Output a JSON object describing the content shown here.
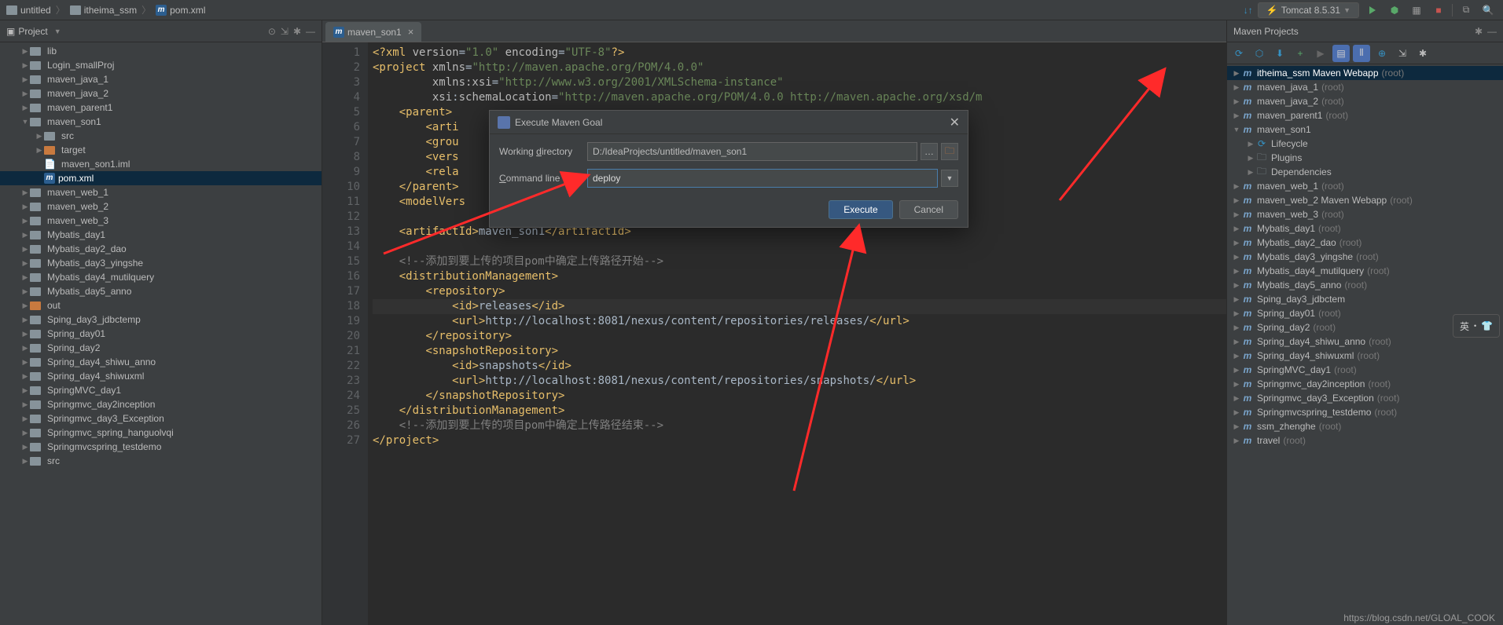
{
  "breadcrumb": {
    "a": "untitled",
    "b": "itheima_ssm",
    "c": "pom.xml"
  },
  "topbar": {
    "run_config": "Tomcat 8.5.31",
    "sync_hint": "↙↘"
  },
  "left_panel": {
    "title": "Project",
    "tree": [
      {
        "depth": 1,
        "arrow": "▶",
        "type": "folder",
        "label": "lib"
      },
      {
        "depth": 1,
        "arrow": "▶",
        "type": "folder",
        "label": "Login_smallProj"
      },
      {
        "depth": 1,
        "arrow": "▶",
        "type": "folder",
        "label": "maven_java_1"
      },
      {
        "depth": 1,
        "arrow": "▶",
        "type": "folder",
        "label": "maven_java_2"
      },
      {
        "depth": 1,
        "arrow": "▶",
        "type": "folder",
        "label": "maven_parent1"
      },
      {
        "depth": 1,
        "arrow": "▼",
        "type": "folder",
        "label": "maven_son1"
      },
      {
        "depth": 2,
        "arrow": "▶",
        "type": "folder",
        "label": "src"
      },
      {
        "depth": 2,
        "arrow": "▶",
        "type": "folder-orange",
        "label": "target"
      },
      {
        "depth": 2,
        "arrow": "",
        "type": "file",
        "label": "maven_son1.iml"
      },
      {
        "depth": 2,
        "arrow": "",
        "type": "m-file",
        "label": "pom.xml",
        "selected": true
      },
      {
        "depth": 1,
        "arrow": "▶",
        "type": "folder",
        "label": "maven_web_1"
      },
      {
        "depth": 1,
        "arrow": "▶",
        "type": "folder",
        "label": "maven_web_2"
      },
      {
        "depth": 1,
        "arrow": "▶",
        "type": "folder",
        "label": "maven_web_3"
      },
      {
        "depth": 1,
        "arrow": "▶",
        "type": "folder",
        "label": "Mybatis_day1"
      },
      {
        "depth": 1,
        "arrow": "▶",
        "type": "folder",
        "label": "Mybatis_day2_dao"
      },
      {
        "depth": 1,
        "arrow": "▶",
        "type": "folder",
        "label": "Mybatis_day3_yingshe"
      },
      {
        "depth": 1,
        "arrow": "▶",
        "type": "folder",
        "label": "Mybatis_day4_mutilquery"
      },
      {
        "depth": 1,
        "arrow": "▶",
        "type": "folder",
        "label": "Mybatis_day5_anno"
      },
      {
        "depth": 1,
        "arrow": "▶",
        "type": "folder-orange",
        "label": "out"
      },
      {
        "depth": 1,
        "arrow": "▶",
        "type": "folder",
        "label": "Sping_day3_jdbctemp"
      },
      {
        "depth": 1,
        "arrow": "▶",
        "type": "folder",
        "label": "Spring_day01"
      },
      {
        "depth": 1,
        "arrow": "▶",
        "type": "folder",
        "label": "Spring_day2"
      },
      {
        "depth": 1,
        "arrow": "▶",
        "type": "folder",
        "label": "Spring_day4_shiwu_anno"
      },
      {
        "depth": 1,
        "arrow": "▶",
        "type": "folder",
        "label": "Spring_day4_shiwuxml"
      },
      {
        "depth": 1,
        "arrow": "▶",
        "type": "folder",
        "label": "SpringMVC_day1"
      },
      {
        "depth": 1,
        "arrow": "▶",
        "type": "folder",
        "label": "Springmvc_day2inception"
      },
      {
        "depth": 1,
        "arrow": "▶",
        "type": "folder",
        "label": "Springmvc_day3_Exception"
      },
      {
        "depth": 1,
        "arrow": "▶",
        "type": "folder",
        "label": "Springmvc_spring_hanguolvqi"
      },
      {
        "depth": 1,
        "arrow": "▶",
        "type": "folder",
        "label": "Springmvcspring_testdemo"
      },
      {
        "depth": 1,
        "arrow": "▶",
        "type": "folder",
        "label": "src"
      }
    ]
  },
  "editor": {
    "tab": "maven_son1",
    "line_numbers": [
      "1",
      "2",
      "3",
      "4",
      "5",
      "6",
      "7",
      "8",
      "9",
      "10",
      "11",
      "12",
      "13",
      "14",
      "15",
      "16",
      "17",
      "18",
      "19",
      "20",
      "21",
      "22",
      "23",
      "24",
      "25",
      "26",
      "27"
    ],
    "code": {
      "l1": "<?xml version=\"1.0\" encoding=\"UTF-8\"?>",
      "l2a": "<project xmlns=",
      "l2b": "\"http://maven.apache.org/POM/4.0.0\"",
      "l3a": "         xmlns:xsi=",
      "l3b": "\"http://www.w3.org/2001/XMLSchema-instance\"",
      "l4a": "         xsi:schemaLocation=",
      "l4b": "\"http://maven.apache.org/POM/4.0.0 http://maven.apache.org/xsd/m",
      "l5": "    <parent>",
      "l6": "        <arti",
      "l7": "        <grou",
      "l8": "        <vers",
      "l9": "        <rela",
      "l10": "    </parent>",
      "l11": "    <modelVers",
      "l12": "",
      "l13a": "    <artifactId>",
      "l13b": "maven_son1",
      "l13c": "</artifactId>",
      "l14": "",
      "l15": "    <!--添加到要上传的项目pom中确定上传路径开始-->",
      "l16": "    <distributionManagement>",
      "l17": "        <repository>",
      "l18a": "            <id>",
      "l18b": "releases",
      "l18c": "</id>",
      "l19a": "            <url>",
      "l19b": "http://localhost:8081/nexus/content/repositories/releases/",
      "l19c": "</url>",
      "l20": "        </repository>",
      "l21": "        <snapshotRepository>",
      "l22a": "            <id>",
      "l22b": "snapshots",
      "l22c": "</id>",
      "l23a": "            <url>",
      "l23b": "http://localhost:8081/nexus/content/repositories/snapshots/",
      "l23c": "</url>",
      "l24": "        </snapshotRepository>",
      "l25": "    </distributionManagement>",
      "l26": "    <!--添加到要上传的项目pom中确定上传路径结束-->",
      "l27": "</project>"
    }
  },
  "dialog": {
    "title": "Execute Maven Goal",
    "wd_label_pre": "Working ",
    "wd_label_u": "d",
    "wd_label_post": "irectory",
    "working_dir": "D:/IdeaProjects/untitled/maven_son1",
    "cl_label_u": "C",
    "cl_label_post": "ommand line",
    "command_line": "deploy",
    "execute": "Execute",
    "cancel": "Cancel"
  },
  "right_panel": {
    "title": "Maven Projects",
    "items": [
      {
        "depth": 0,
        "arrow": "▶",
        "label": "itheima_ssm Maven Webapp",
        "hint": "(root)",
        "selected": true,
        "type": "maven"
      },
      {
        "depth": 0,
        "arrow": "▶",
        "label": "maven_java_1",
        "hint": "(root)",
        "type": "maven"
      },
      {
        "depth": 0,
        "arrow": "▶",
        "label": "maven_java_2",
        "hint": "(root)",
        "type": "maven"
      },
      {
        "depth": 0,
        "arrow": "▶",
        "label": "maven_parent1",
        "hint": "(root)",
        "type": "maven"
      },
      {
        "depth": 0,
        "arrow": "▼",
        "label": "maven_son1",
        "hint": "",
        "type": "maven"
      },
      {
        "depth": 1,
        "arrow": "▶",
        "label": "Lifecycle",
        "hint": "",
        "type": "cycle"
      },
      {
        "depth": 1,
        "arrow": "▶",
        "label": "Plugins",
        "hint": "",
        "type": "folder"
      },
      {
        "depth": 1,
        "arrow": "▶",
        "label": "Dependencies",
        "hint": "",
        "type": "folder"
      },
      {
        "depth": 0,
        "arrow": "▶",
        "label": "maven_web_1",
        "hint": "(root)",
        "type": "maven"
      },
      {
        "depth": 0,
        "arrow": "▶",
        "label": "maven_web_2 Maven Webapp",
        "hint": "(root)",
        "type": "maven"
      },
      {
        "depth": 0,
        "arrow": "▶",
        "label": "maven_web_3",
        "hint": "(root)",
        "type": "maven"
      },
      {
        "depth": 0,
        "arrow": "▶",
        "label": "Mybatis_day1",
        "hint": "(root)",
        "type": "maven"
      },
      {
        "depth": 0,
        "arrow": "▶",
        "label": "Mybatis_day2_dao",
        "hint": "(root)",
        "type": "maven"
      },
      {
        "depth": 0,
        "arrow": "▶",
        "label": "Mybatis_day3_yingshe",
        "hint": "(root)",
        "type": "maven"
      },
      {
        "depth": 0,
        "arrow": "▶",
        "label": "Mybatis_day4_mutilquery",
        "hint": "(root)",
        "type": "maven"
      },
      {
        "depth": 0,
        "arrow": "▶",
        "label": "Mybatis_day5_anno",
        "hint": "(root)",
        "type": "maven"
      },
      {
        "depth": 0,
        "arrow": "▶",
        "label": "Sping_day3_jdbctem",
        "hint": "",
        "type": "maven"
      },
      {
        "depth": 0,
        "arrow": "▶",
        "label": "Spring_day01",
        "hint": "(root)",
        "type": "maven"
      },
      {
        "depth": 0,
        "arrow": "▶",
        "label": "Spring_day2",
        "hint": "(root)",
        "type": "maven"
      },
      {
        "depth": 0,
        "arrow": "▶",
        "label": "Spring_day4_shiwu_anno",
        "hint": "(root)",
        "type": "maven"
      },
      {
        "depth": 0,
        "arrow": "▶",
        "label": "Spring_day4_shiwuxml",
        "hint": "(root)",
        "type": "maven"
      },
      {
        "depth": 0,
        "arrow": "▶",
        "label": "SpringMVC_day1",
        "hint": "(root)",
        "type": "maven"
      },
      {
        "depth": 0,
        "arrow": "▶",
        "label": "Springmvc_day2inception",
        "hint": "(root)",
        "type": "maven"
      },
      {
        "depth": 0,
        "arrow": "▶",
        "label": "Springmvc_day3_Exception",
        "hint": "(root)",
        "type": "maven"
      },
      {
        "depth": 0,
        "arrow": "▶",
        "label": "Springmvcspring_testdemo",
        "hint": "(root)",
        "type": "maven"
      },
      {
        "depth": 0,
        "arrow": "▶",
        "label": "ssm_zhenghe",
        "hint": "(root)",
        "type": "maven"
      },
      {
        "depth": 0,
        "arrow": "▶",
        "label": "travel",
        "hint": "(root)",
        "type": "maven"
      }
    ]
  },
  "watermark": "https://blog.csdn.net/GLOAL_COOK",
  "ime": "英"
}
